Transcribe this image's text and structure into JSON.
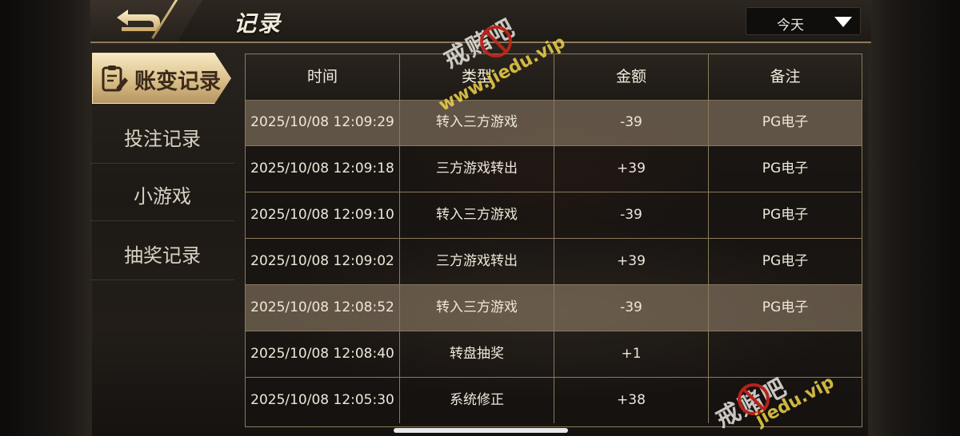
{
  "header": {
    "title": "记录",
    "date_filter": {
      "selected": "今天"
    }
  },
  "sidebar": {
    "items": [
      {
        "label": "账变记录",
        "active": true
      },
      {
        "label": "投注记录",
        "active": false
      },
      {
        "label": "小游戏",
        "active": false
      },
      {
        "label": "抽奖记录",
        "active": false
      }
    ]
  },
  "table": {
    "columns": [
      "时间",
      "类型",
      "金额",
      "备注"
    ],
    "rows": [
      {
        "time": "2025/10/08 12:09:29",
        "type": "转入三方游戏",
        "amount": "-39",
        "note": "PG电子",
        "highlight": true
      },
      {
        "time": "2025/10/08 12:09:18",
        "type": "三方游戏转出",
        "amount": "+39",
        "note": "PG电子",
        "highlight": false
      },
      {
        "time": "2025/10/08 12:09:10",
        "type": "转入三方游戏",
        "amount": "-39",
        "note": "PG电子",
        "highlight": false
      },
      {
        "time": "2025/10/08 12:09:02",
        "type": "三方游戏转出",
        "amount": "+39",
        "note": "PG电子",
        "highlight": false
      },
      {
        "time": "2025/10/08 12:08:52",
        "type": "转入三方游戏",
        "amount": "-39",
        "note": "PG电子",
        "highlight": true
      },
      {
        "time": "2025/10/08 12:08:40",
        "type": "转盘抽奖",
        "amount": "+1",
        "note": "",
        "highlight": false
      },
      {
        "time": "2025/10/08 12:05:30",
        "type": "系统修正",
        "amount": "+38",
        "note": "",
        "highlight": false
      }
    ]
  },
  "watermarks": [
    {
      "text": "戒赌吧",
      "url": "www.jiedu.vip"
    },
    {
      "text": "戒赌吧",
      "url": "jiedu.vip"
    }
  ],
  "colors": {
    "accent_gold": "#d9bf88",
    "row_highlight": "#786a58",
    "border": "#8a7a5d"
  }
}
